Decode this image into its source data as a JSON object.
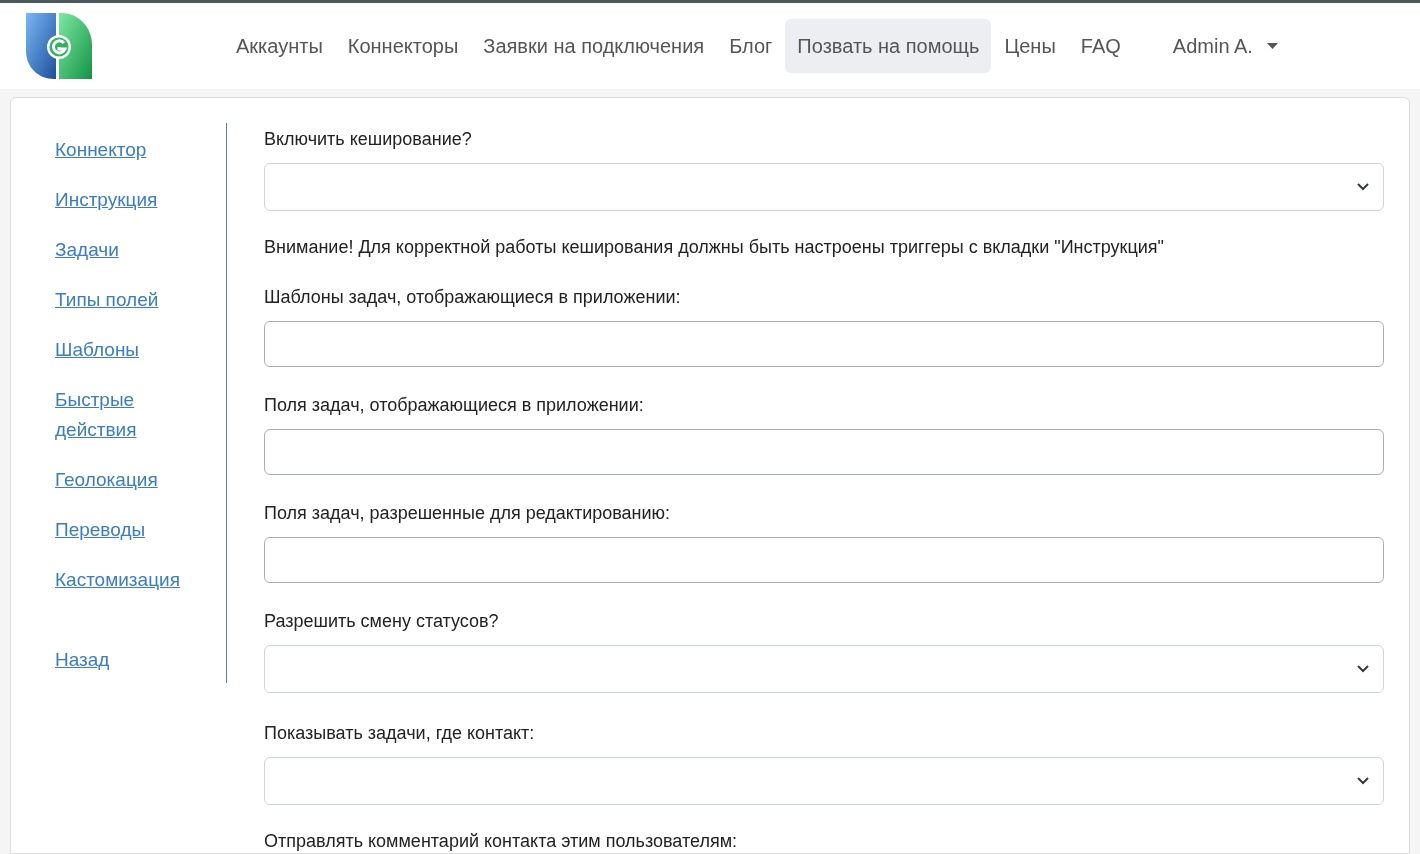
{
  "nav": {
    "items": [
      {
        "label": "Аккаунты",
        "selected": false
      },
      {
        "label": "Коннекторы",
        "selected": false
      },
      {
        "label": "Заявки на подключения",
        "selected": false
      },
      {
        "label": "Блог",
        "selected": false
      },
      {
        "label": "Позвать на помощь",
        "selected": true
      },
      {
        "label": "Цены",
        "selected": false
      },
      {
        "label": "FAQ",
        "selected": false
      }
    ],
    "user": "Admin A."
  },
  "sidebar": {
    "items": [
      {
        "label": "Коннектор"
      },
      {
        "label": "Инструкция"
      },
      {
        "label": "Задачи"
      },
      {
        "label": "Типы полей"
      },
      {
        "label": "Шаблоны"
      },
      {
        "label": "Быстрые действия"
      },
      {
        "label": "Геолокация"
      },
      {
        "label": "Переводы"
      },
      {
        "label": "Кастомизация"
      }
    ],
    "back": "Назад"
  },
  "form": [
    {
      "kind": "select",
      "label": "Включить кеширование?"
    },
    {
      "kind": "note",
      "text": "Внимание! Для корректной работы кеширования должны быть настроены триггеры с вкладки \"Инструкция\""
    },
    {
      "kind": "input",
      "label": "Шаблоны задач, отображающиеся в приложении:"
    },
    {
      "kind": "input",
      "label": "Поля задач, отображающиеся в приложении:"
    },
    {
      "kind": "input",
      "label": "Поля задач, разрешенные для редактированию:"
    },
    {
      "kind": "select",
      "label": "Разрешить смену статусов?"
    },
    {
      "kind": "select",
      "label": "Показывать задачи, где контакт:"
    },
    {
      "kind": "label",
      "label": "Отправлять комментарий контакта этим пользователям:"
    }
  ]
}
